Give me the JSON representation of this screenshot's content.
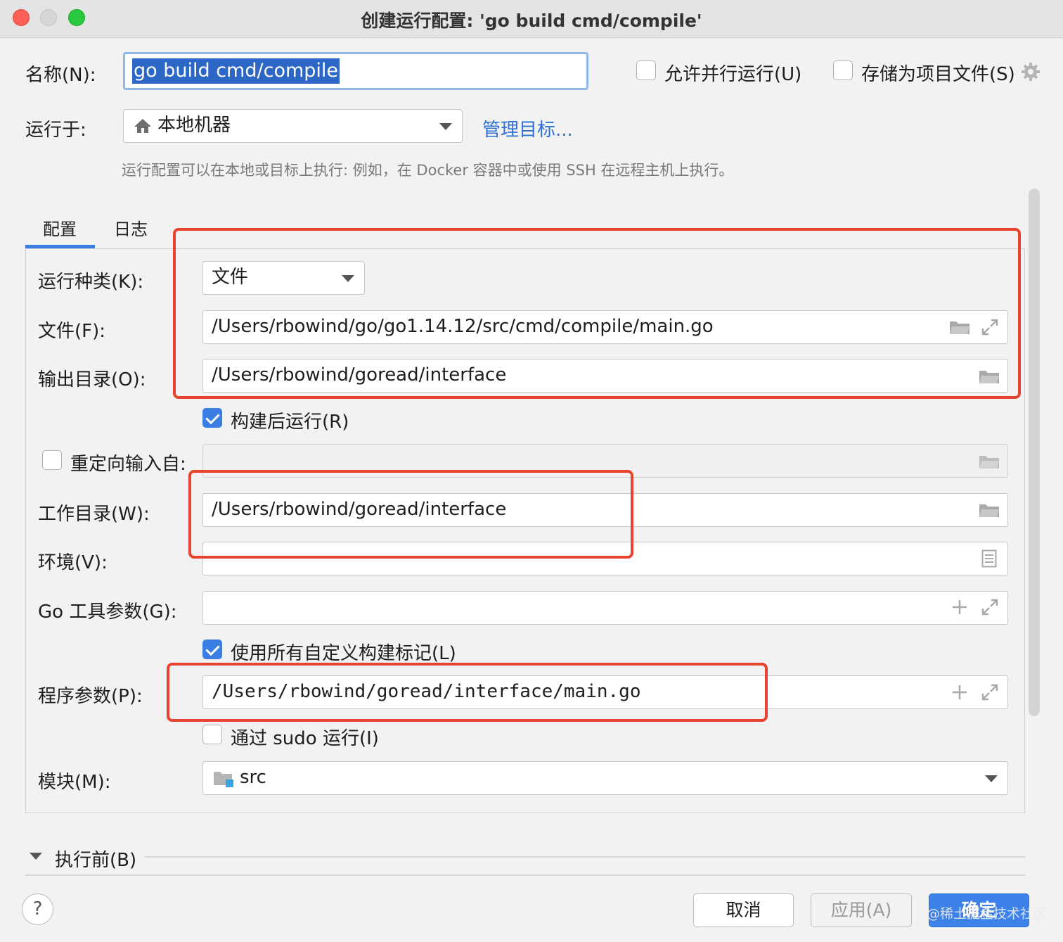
{
  "window": {
    "title": "创建运行配置: 'go build cmd/compile'"
  },
  "name": {
    "label": "名称(N):",
    "value": "go build cmd/compile"
  },
  "options": {
    "allow_parallel": {
      "label": "允许并行运行(U)",
      "checked": false
    },
    "store_as_project_file": {
      "label": "存储为项目文件(S)",
      "checked": false
    }
  },
  "run_on": {
    "label": "运行于:",
    "value": "本地机器",
    "manage_targets": "管理目标...",
    "hint": "运行配置可以在本地或目标上执行: 例如，在 Docker 容器中或使用 SSH 在远程主机上执行。"
  },
  "tabs": [
    {
      "label": "配置",
      "active": true
    },
    {
      "label": "日志",
      "active": false
    }
  ],
  "form": {
    "run_kind": {
      "label": "运行种类(K):",
      "value": "文件"
    },
    "file": {
      "label": "文件(F):",
      "value": "/Users/rbowind/go/go1.14.12/src/cmd/compile/main.go"
    },
    "output_dir": {
      "label": "输出目录(O):",
      "value": "/Users/rbowind/goread/interface"
    },
    "run_after_build": {
      "label": "构建后运行(R)",
      "checked": true
    },
    "redirect_input": {
      "label": "重定向输入自:",
      "checked": false,
      "value": ""
    },
    "working_dir": {
      "label": "工作目录(W):",
      "value": "/Users/rbowind/goread/interface"
    },
    "environment": {
      "label": "环境(V):",
      "value": ""
    },
    "go_tool_args": {
      "label": "Go 工具参数(G):",
      "value": ""
    },
    "use_custom_tags": {
      "label": "使用所有自定义构建标记(L)",
      "checked": true
    },
    "program_args": {
      "label": "程序参数(P):",
      "value": "/Users/rbowind/goread/interface/main.go"
    },
    "run_with_sudo": {
      "label": "通过 sudo 运行(I)",
      "checked": false
    },
    "module": {
      "label": "模块(M):",
      "value": "src"
    }
  },
  "before_launch": {
    "label": "执行前(B)"
  },
  "buttons": {
    "help": "?",
    "cancel": "取消",
    "apply": "应用(A)",
    "ok": "确定"
  },
  "watermark": "@稀土掘金技术社区",
  "colors": {
    "accent": "#3a7ee4",
    "annotation": "#e8432f",
    "link": "#2f70d6"
  }
}
